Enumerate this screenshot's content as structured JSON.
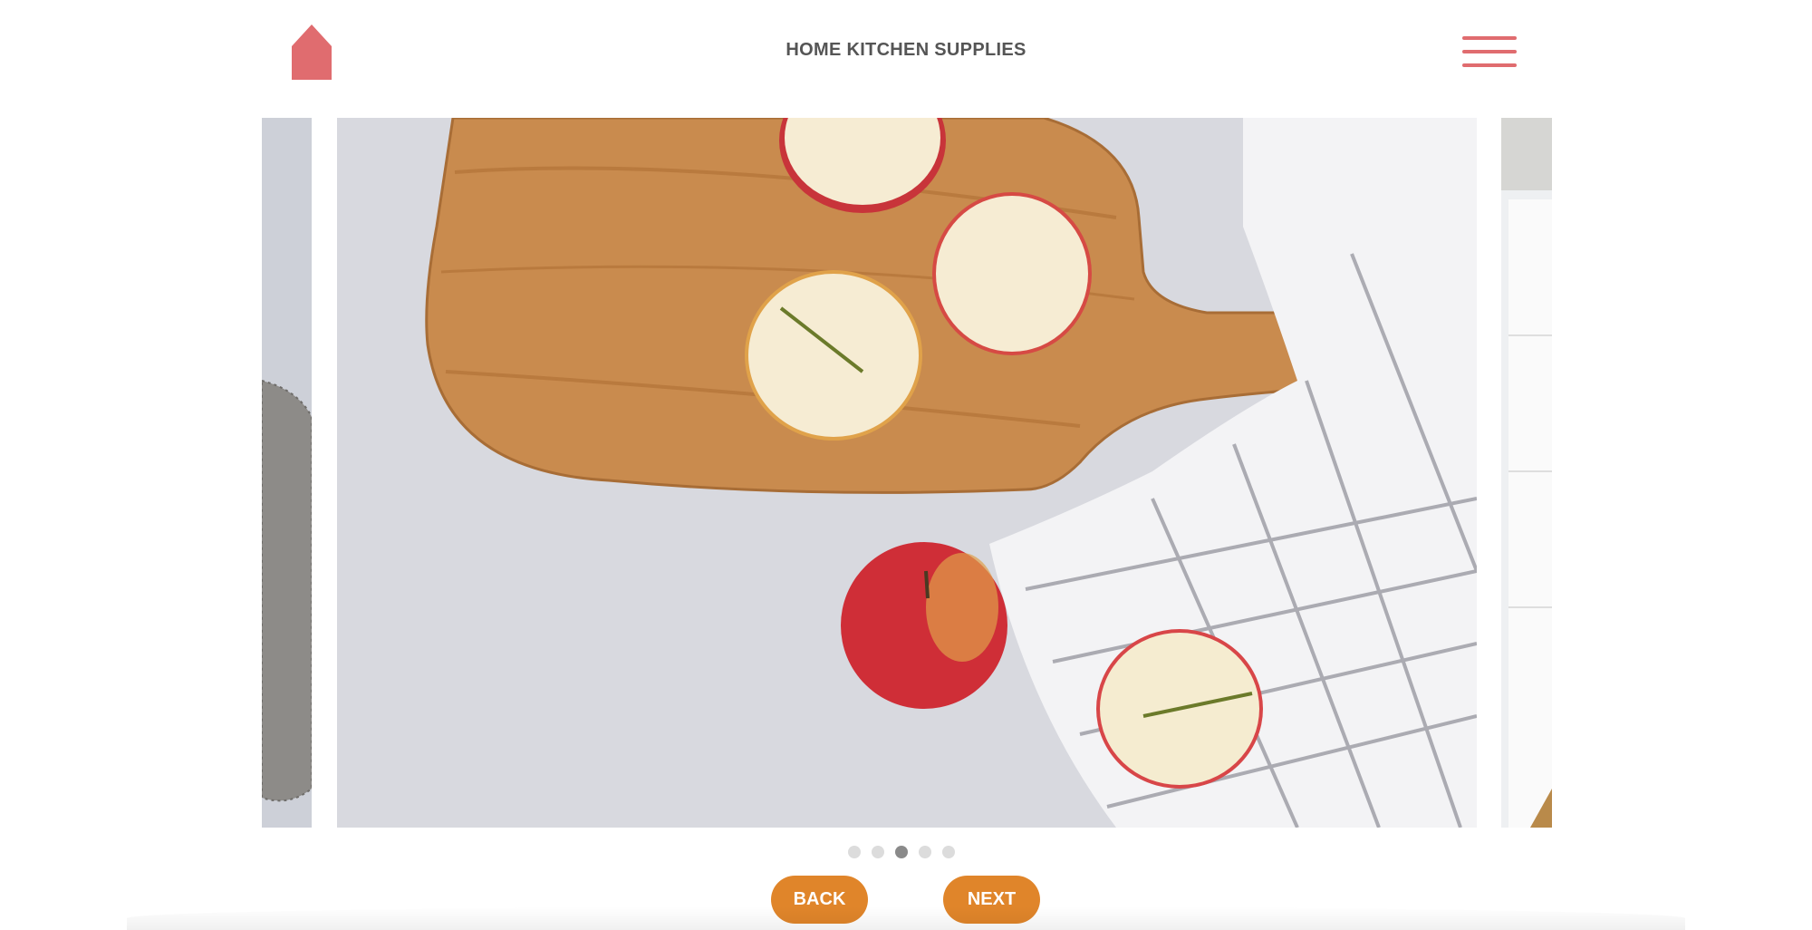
{
  "header": {
    "title": "HOME KITCHEN SUPPLIES",
    "home_icon": "home-icon",
    "menu_icon": "hamburger-menu-icon"
  },
  "carousel": {
    "current_slide": 3,
    "total_slides": 5,
    "slides": [
      {
        "icon": "photo-image"
      },
      {
        "icon": "photo-image"
      },
      {
        "icon": "photo-image"
      },
      {
        "icon": "photo-image"
      },
      {
        "icon": "photo-image"
      }
    ]
  },
  "buttons": {
    "back_label": "BACK",
    "next_label": "NEXT"
  },
  "colors": {
    "accent_orange": "#e0852a",
    "brand_red": "#e06c6f",
    "title_gray": "#555555",
    "dot_active": "#8a8a8a",
    "dot_inactive": "#dcdcdc"
  }
}
